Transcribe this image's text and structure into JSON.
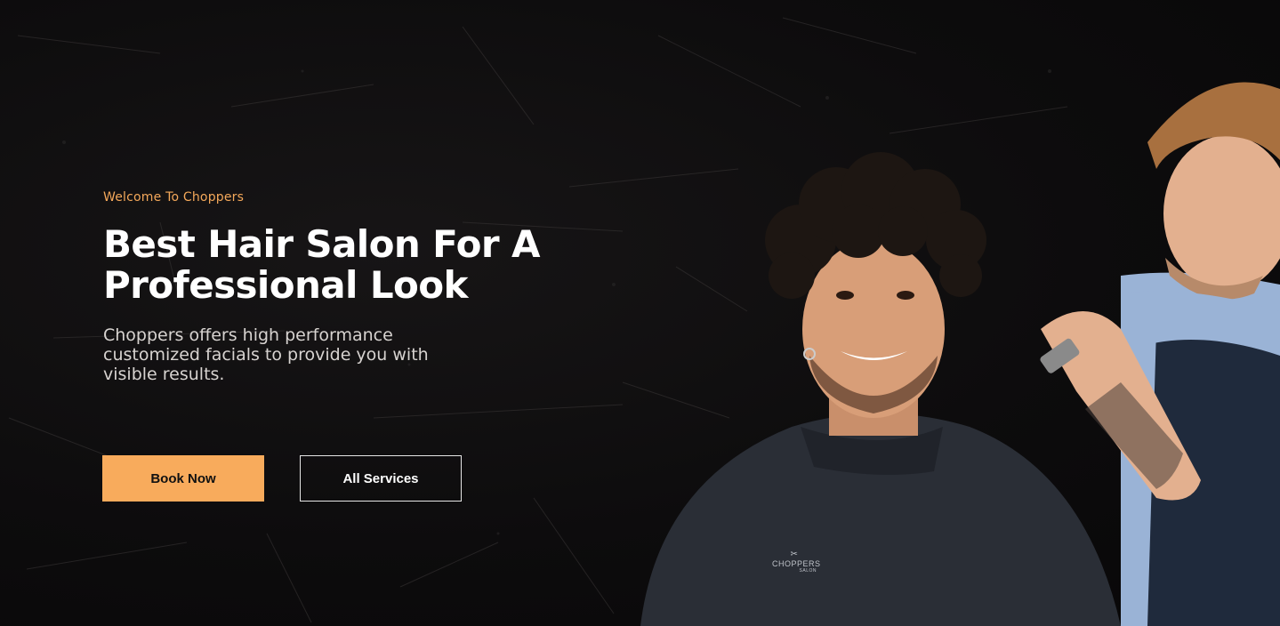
{
  "hero": {
    "tagline": "Welcome To Choppers",
    "title": "Best Hair Salon For A Professional Look",
    "subtitle": "Choppers offers high performance customized facials to provide you with visible results.",
    "primary_button": "Book Now",
    "secondary_button": "All Services",
    "cape_logo": "CHOPPERS",
    "cape_logo_sub": "SALON"
  },
  "colors": {
    "accent": "#f8ab5c",
    "background": "#0c0b0c",
    "text": "#ffffff"
  },
  "icons": [
    "scissors-logo-icon"
  ]
}
